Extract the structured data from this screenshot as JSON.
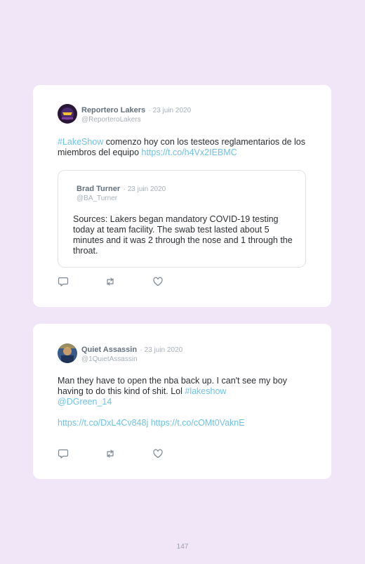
{
  "tweets": [
    {
      "name": "Reportero Lakers",
      "date": "· 23 juin 2020",
      "handle": "@ReporteroLakers",
      "text": {
        "hashtag": "#LakeShow",
        "body": " comenzo hoy con los testeos reglamentarios de los miembros del equipo ",
        "link": "https://t.co/h4Vx2IEBMC"
      },
      "quote": {
        "name": "Brad Turner",
        "date": "· 23 juin 2020",
        "handle": "@BA_Turner",
        "text": "Sources: Lakers began mandatory COVID-19 testing today at team facility. The swab test lasted about 5 minutes and it was 2 through the nose and 1 through the throat."
      }
    },
    {
      "name": "Quiet Assassin",
      "date": "· 23 juin 2020",
      "handle": "@1QuietAssassin",
      "text": {
        "body": "Man they have to open the nba back up. I can't see my boy having to do this kind of shit. Lol ",
        "hashtag": "#lakeshow",
        "mention": "@DGreen_14",
        "link1": "https://t.co/DxL4Cv848j",
        "link2": "https://t.co/cOMt0VaknE"
      }
    }
  ],
  "icons": [
    "reply-icon",
    "retweet-icon",
    "like-icon"
  ],
  "colors": {
    "background": "#f1e5f8",
    "link": "#6ec2e8",
    "name": "#63707c"
  },
  "page_number": "147"
}
